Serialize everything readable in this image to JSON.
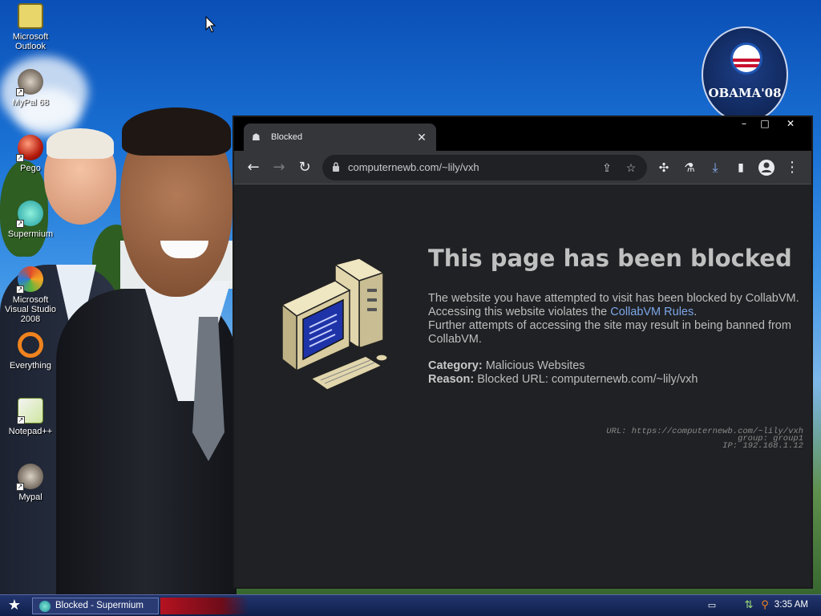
{
  "desktop": {
    "icons": [
      {
        "label": "Microsoft Outlook",
        "icon": "outlook-icon"
      },
      {
        "label": "MyPal 68",
        "icon": "mypal-raccoon-icon"
      },
      {
        "label": "Pego",
        "icon": "pego-orb-icon"
      },
      {
        "label": "Supermium",
        "icon": "supermium-icon"
      },
      {
        "label": "Microsoft Visual Studio 2008",
        "icon": "visual-studio-icon"
      },
      {
        "label": "Everything",
        "icon": "everything-search-icon"
      },
      {
        "label": "Notepad++",
        "icon": "notepadpp-icon"
      },
      {
        "label": "Mypal",
        "icon": "mypal-raccoon-icon"
      }
    ],
    "wallpaper_badge": "OBAMA'08"
  },
  "browser": {
    "tab_title": "Blocked",
    "url": "computernewb.com/~lily/vxh",
    "window_controls": {
      "minimize": "–",
      "maximize": "□",
      "close": "✕"
    },
    "page": {
      "headline": "This page has been blocked",
      "line1": "The website you have attempted to visit has been blocked by CollabVM.",
      "line2_prefix": "Accessing this website violates the ",
      "line2_link": "CollabVM Rules",
      "line2_suffix": ".",
      "line3": "Further attempts of accessing the site may result in being banned from CollabVM.",
      "category_label": "Category:",
      "category_value": "Malicious Websites",
      "reason_label": "Reason:",
      "reason_value": "Blocked URL: computernewb.com/~lily/vxh",
      "meta_url": "URL: https://computernewb.com/~lily/vxh",
      "meta_group": "group: group1",
      "meta_ip": "IP: 192.168.1.12"
    }
  },
  "taskbar": {
    "task_label": "Blocked - Supermium",
    "clock": "3:35 AM"
  },
  "colors": {
    "accent_link": "#7ba6e8",
    "page_bg": "#202124",
    "toolbar_bg": "#35363a",
    "taskbar_bg": "#1a2a5c"
  }
}
